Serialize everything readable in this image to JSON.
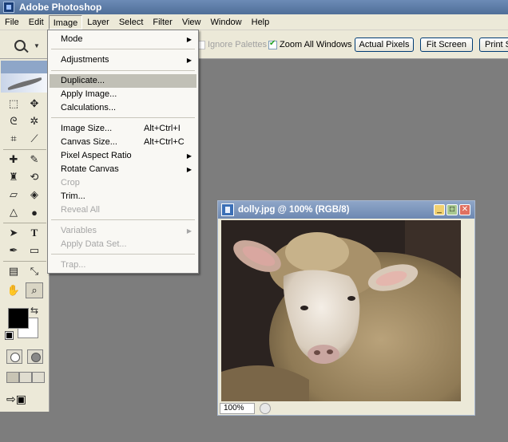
{
  "window": {
    "title": "Adobe Photoshop"
  },
  "menubar": {
    "items": [
      {
        "label": "File"
      },
      {
        "label": "Edit"
      },
      {
        "label": "Image"
      },
      {
        "label": "Layer"
      },
      {
        "label": "Select"
      },
      {
        "label": "Filter"
      },
      {
        "label": "View"
      },
      {
        "label": "Window"
      },
      {
        "label": "Help"
      }
    ]
  },
  "options": {
    "ignore_palettes": "Ignore Palettes",
    "zoom_all_windows": "Zoom All Windows",
    "actual_pixels": "Actual Pixels",
    "fit_screen": "Fit Screen",
    "print_size": "Print S"
  },
  "image_menu": {
    "mode": "Mode",
    "adjustments": "Adjustments",
    "duplicate": "Duplicate...",
    "apply_image": "Apply Image...",
    "calculations": "Calculations...",
    "image_size": "Image Size...",
    "image_size_shortcut": "Alt+Ctrl+I",
    "canvas_size": "Canvas Size...",
    "canvas_size_shortcut": "Alt+Ctrl+C",
    "pixel_aspect_ratio": "Pixel Aspect Ratio",
    "rotate_canvas": "Rotate Canvas",
    "crop": "Crop",
    "trim": "Trim...",
    "reveal_all": "Reveal All",
    "variables": "Variables",
    "apply_data_set": "Apply Data Set...",
    "trap": "Trap..."
  },
  "document": {
    "title": "dolly.jpg @ 100% (RGB/8)",
    "zoom": "100%"
  },
  "colors": {
    "foreground": "#000000",
    "background": "#ffffff",
    "accent": "#6d88b2"
  }
}
